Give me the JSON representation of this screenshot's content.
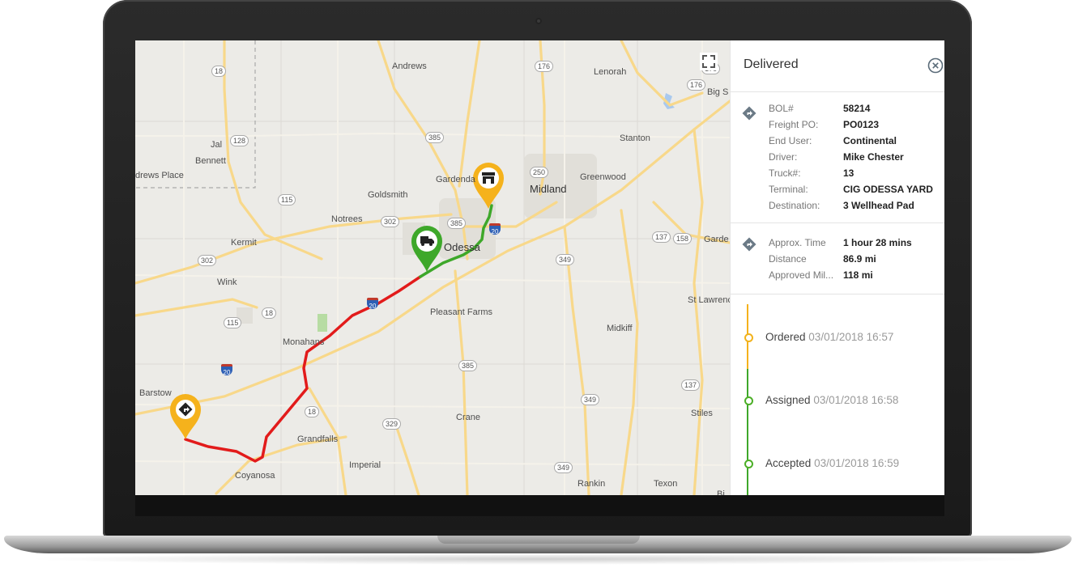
{
  "map": {
    "places": {
      "andrews": "Andrews",
      "lenorah": "Lenorah",
      "big_spring": "Big S",
      "stanton": "Stanton",
      "jal": "Jal",
      "bennett": "Bennett",
      "andrews_place": "drews Place",
      "gardendale": "Gardenda",
      "greenwood": "Greenwood",
      "midland": "Midland",
      "goldsmith": "Goldsmith",
      "notrees": "Notrees",
      "odessa": "Odessa",
      "kermit": "Kermit",
      "garden_city": "Garde",
      "wink": "Wink",
      "st_lawrence": "St Lawrenc",
      "pleasant_farms": "Pleasant Farms",
      "monahans": "Monahans",
      "midkiff": "Midkiff",
      "barstow": "Barstow",
      "stiles": "Stiles",
      "crane": "Crane",
      "grandfalls": "Grandfalls",
      "imperial": "Imperial",
      "coyanosa": "Coyanosa",
      "rankin": "Rankin",
      "texon": "Texon",
      "big_lake": "Bi"
    },
    "shields": {
      "r18a": "18",
      "r176a": "176",
      "r176b": "176",
      "r176c": "176",
      "r128": "128",
      "r385a": "385",
      "r250": "250",
      "r115": "115",
      "r302a": "302",
      "r385b": "385",
      "r302b": "302",
      "r349a": "349",
      "r137a": "137",
      "r158": "158",
      "r18b": "18",
      "r115b": "115",
      "r385c": "385",
      "r137b": "137",
      "r18c": "18",
      "r329": "329",
      "r349b": "349",
      "r349c": "349",
      "r20a": "20",
      "r20b": "20",
      "r20c": "20"
    }
  },
  "panel": {
    "title": "Delivered",
    "details": [
      {
        "label": "BOL#",
        "value": "58214"
      },
      {
        "label": "Freight PO:",
        "value": "PO0123"
      },
      {
        "label": "End User:",
        "value": "Continental"
      },
      {
        "label": "Driver:",
        "value": "Mike Chester"
      },
      {
        "label": "Truck#:",
        "value": "13"
      },
      {
        "label": "Terminal:",
        "value": "CIG ODESSA YARD"
      },
      {
        "label": "Destination:",
        "value": "3 Wellhead Pad"
      }
    ],
    "trip": [
      {
        "label": "Approx. Time",
        "value": "1 hour 28 mins"
      },
      {
        "label": "Distance",
        "value": "86.9 mi"
      },
      {
        "label": "Approved Mil...",
        "value": "118 mi"
      }
    ],
    "timeline": [
      {
        "status": "Ordered",
        "time": "03/01/2018 16:57",
        "color": "#f2b21b"
      },
      {
        "status": "Assigned",
        "time": "03/01/2018 16:58",
        "color": "#4caf27"
      },
      {
        "status": "Accepted",
        "time": "03/01/2018 16:59",
        "color": "#4caf27"
      }
    ]
  },
  "colors": {
    "route_traveled": "#e21b1b",
    "route_remaining": "#3ea82a",
    "pin_yellow": "#f5b21c",
    "pin_green": "#3ea82a",
    "highway": "#f8d88a"
  }
}
